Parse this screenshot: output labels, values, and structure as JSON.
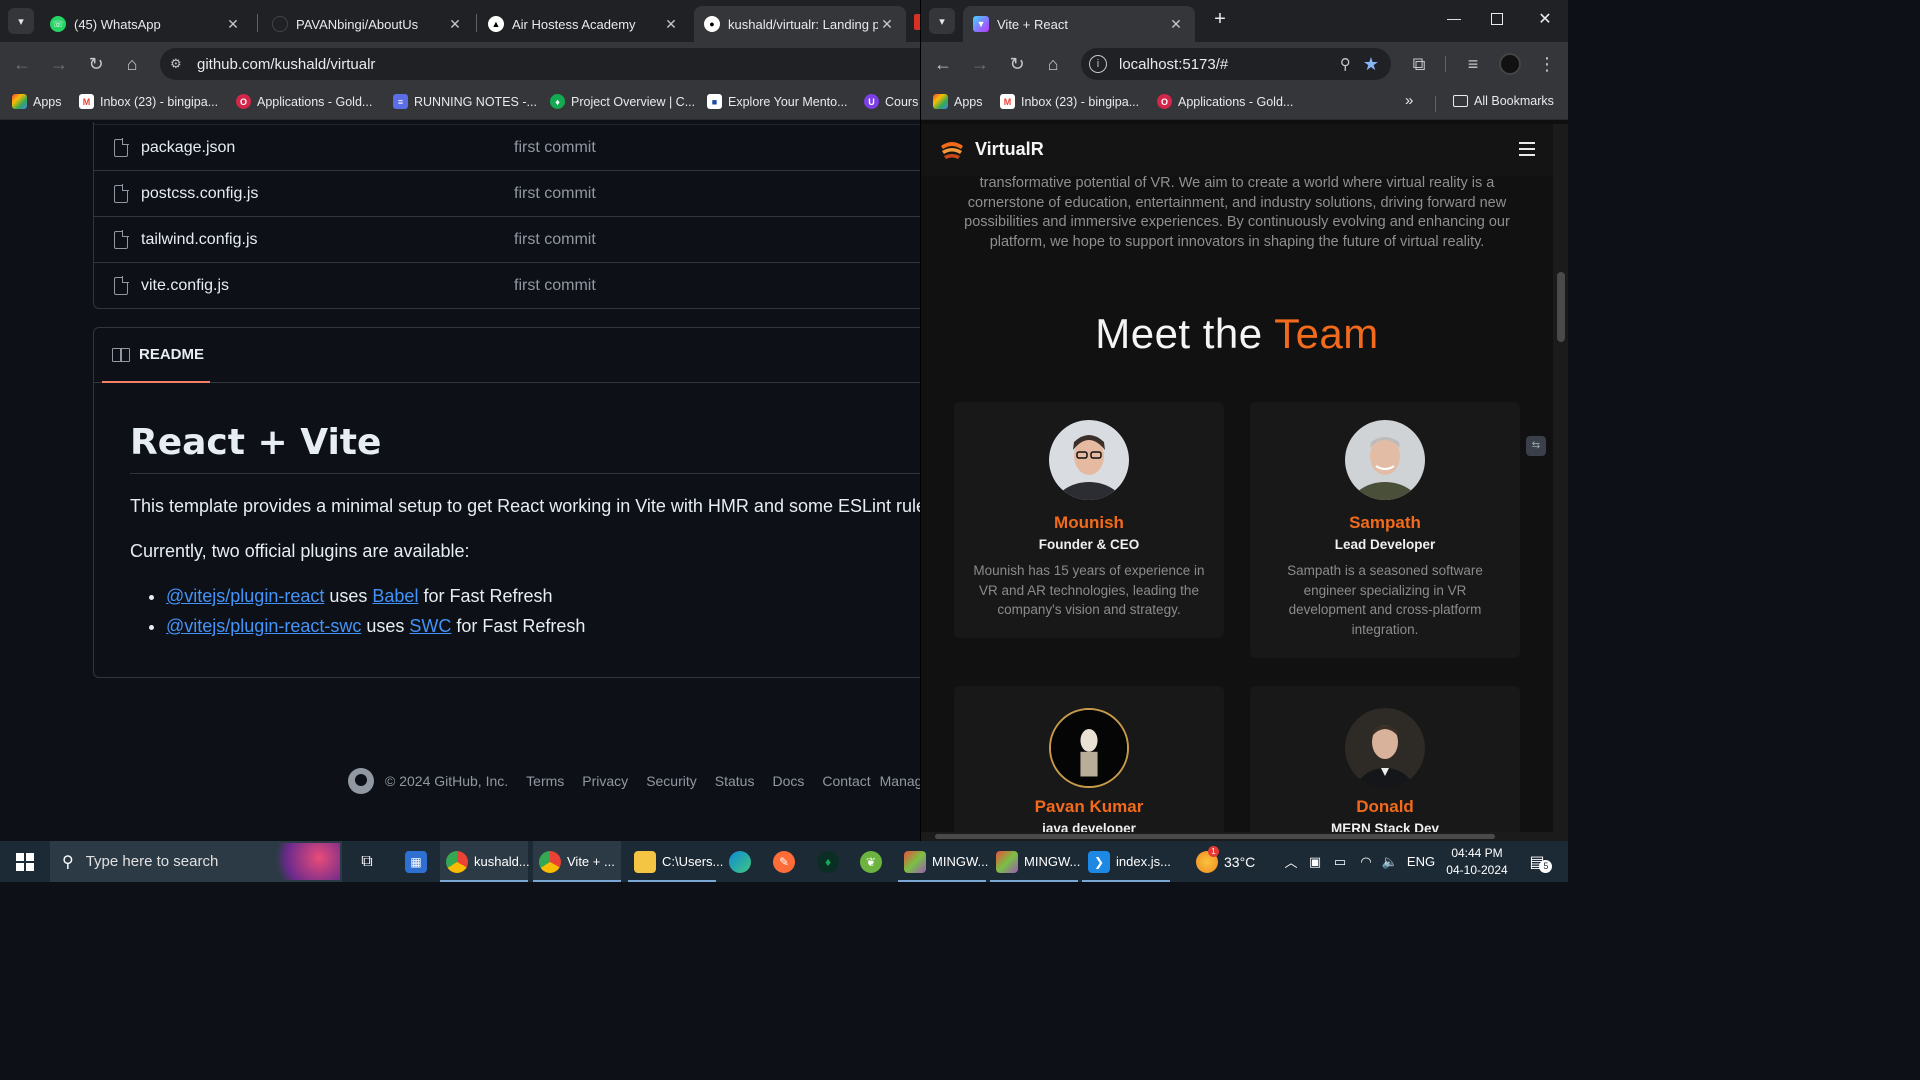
{
  "left_browser": {
    "tabs": [
      {
        "title": "(45) WhatsApp",
        "badge": "45",
        "favicon": "whatsapp-icon",
        "color": "#25d366"
      },
      {
        "title": "PAVANbingi/AboutUs",
        "favicon": "github-icon",
        "color": "#202124"
      },
      {
        "title": "Air Hostess Academy",
        "favicon": "triangle-logo-icon",
        "color": "#ffffff"
      },
      {
        "title": "kushald/virtualr: Landing p",
        "favicon": "github-icon",
        "color": "#ffffff"
      }
    ],
    "url": "github.com/kushald/virtualr",
    "bookmarks": [
      {
        "label": "Apps",
        "icon": "apps-grid-icon"
      },
      {
        "label": "Inbox (23) - bingipa...",
        "icon": "gmail-icon"
      },
      {
        "label": "Applications - Gold...",
        "icon": "opera-icon"
      },
      {
        "label": "RUNNING NOTES -...",
        "icon": "notes-icon"
      },
      {
        "label": "Project Overview | C...",
        "icon": "mongodb-icon"
      },
      {
        "label": "Explore Your Mento...",
        "icon": "mentor-icon"
      },
      {
        "label": "Cours",
        "icon": "course-icon"
      }
    ]
  },
  "github": {
    "files": [
      {
        "name": "package.json",
        "message": "first commit"
      },
      {
        "name": "postcss.config.js",
        "message": "first commit"
      },
      {
        "name": "tailwind.config.js",
        "message": "first commit"
      },
      {
        "name": "vite.config.js",
        "message": "first commit"
      }
    ],
    "readme_tab": "README",
    "readme_title": "React + Vite",
    "readme_intro": "This template provides a minimal setup to get React working in Vite with HMR and some ESLint rules",
    "readme_plugins_intro": "Currently, two official plugins are available:",
    "plugins": [
      {
        "pkg": "@vitejs/plugin-react",
        "uses": "uses",
        "tool": "Babel",
        "suffix": "for Fast Refresh"
      },
      {
        "pkg": "@vitejs/plugin-react-swc",
        "uses": "uses",
        "tool": "SWC",
        "suffix": "for Fast Refresh"
      }
    ],
    "footer": {
      "copyright": "© 2024 GitHub, Inc.",
      "links": [
        "Terms",
        "Privacy",
        "Security",
        "Status",
        "Docs",
        "Contact",
        "Manage co"
      ]
    }
  },
  "right_browser": {
    "tab_title": "Vite + React",
    "url": "localhost:5173/#",
    "bookmarks": [
      {
        "label": "Apps"
      },
      {
        "label": "Inbox (23) - bingipa..."
      },
      {
        "label": "Applications - Gold..."
      }
    ],
    "all_bookmarks": "All Bookmarks",
    "more_chevron": "»"
  },
  "site": {
    "brand": "VirtualR",
    "about_text": "transformative potential of VR. We aim to create a world where virtual reality is a cornerstone of education, entertainment, and industry solutions, driving forward new possibilities and immersive experiences. By continuously evolving and enhancing our platform, we hope to support innovators in shaping the future of virtual reality.",
    "team_title_main": "Meet the",
    "team_title_accent": "Team",
    "accent_color": "#f26a1b",
    "team": [
      {
        "name": "Mounish",
        "role": "Founder & CEO",
        "bio": "Mounish has 15 years of experience in VR and AR technologies, leading the company's vision and strategy."
      },
      {
        "name": "Sampath",
        "role": "Lead Developer",
        "bio": "Sampath is a seasoned software engineer specializing in VR development and cross-platform integration."
      },
      {
        "name": "Pavan Kumar",
        "role": "java developer",
        "bio": ""
      },
      {
        "name": "Donald",
        "role": "MERN Stack Dev",
        "bio": ""
      }
    ]
  },
  "taskbar": {
    "search_placeholder": "Type here to search",
    "apps": [
      {
        "label": "kushald...",
        "icon": "chrome-icon"
      },
      {
        "label": "Vite + ...",
        "icon": "chrome-icon"
      },
      {
        "label": "C:\\Users...",
        "icon": "folder-icon"
      },
      {
        "label": "MINGW...",
        "icon": "git-bash-icon"
      },
      {
        "label": "MINGW...",
        "icon": "git-bash-icon"
      },
      {
        "label": "index.js...",
        "icon": "vscode-icon"
      }
    ],
    "weather": "33°C",
    "weather_badge": "1",
    "language": "ENG",
    "time": "04:44 PM",
    "date": "04-10-2024",
    "notification_count": "5"
  }
}
